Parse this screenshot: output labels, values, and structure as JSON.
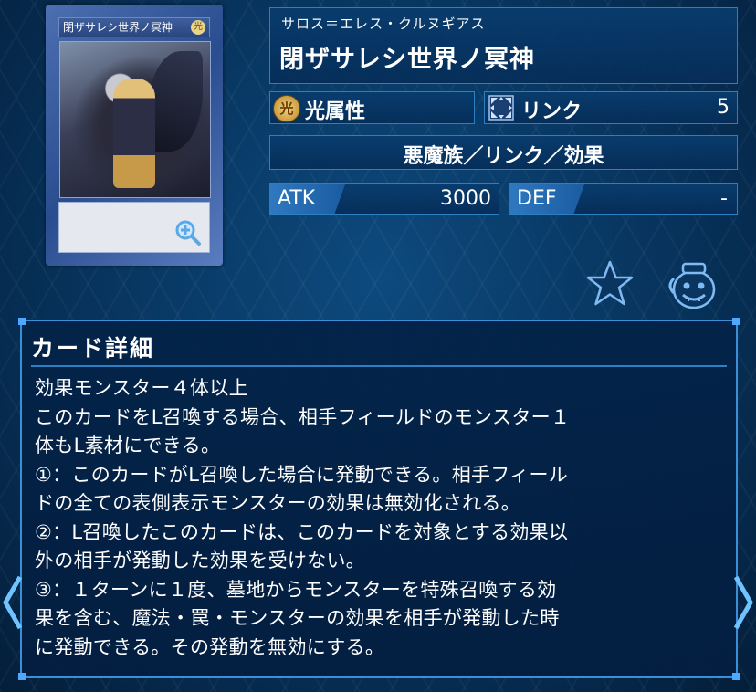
{
  "card_image": {
    "name_label": "閉ザサレシ世界ノ冥神",
    "attribute_glyph": "光"
  },
  "card": {
    "reading": "サロス＝エレス・クルヌギアス",
    "name": "閉ザサレシ世界ノ冥神",
    "attribute": "光属性",
    "attribute_glyph": "光",
    "link_label": "リンク",
    "link_rating": "5",
    "types": "悪魔族／リンク／効果",
    "atk_label": "ATK",
    "atk_value": "3000",
    "def_label": "DEF",
    "def_value": "-"
  },
  "detail": {
    "heading": "カード詳細",
    "text": "効果モンスター４体以上\nこのカードをL召喚する場合、相手フィールドのモンスター１\n体もL素材にできる。\n①：このカードがL召喚した場合に発動できる。相手フィール\nドの全ての表側表示モンスターの効果は無効化される。\n②：L召喚したこのカードは、このカードを対象とする効果以\n外の相手が発動した効果を受けない。\n③：１ターンに１度、墓地からモンスターを特殊召喚する効\n果を含む、魔法・罠・モンスターの効果を相手が発動した時\nに発動できる。その発動を無効にする。"
  },
  "icons": {
    "favorite": "star-icon",
    "deck_pot": "pot-of-greed-icon",
    "zoom": "zoom-in-icon",
    "prev": "chevron-left-icon",
    "next": "chevron-right-icon"
  },
  "colors": {
    "panel_border": "#2d7fc4",
    "background": "#07335c",
    "atk_tag": "#2f78c0"
  }
}
